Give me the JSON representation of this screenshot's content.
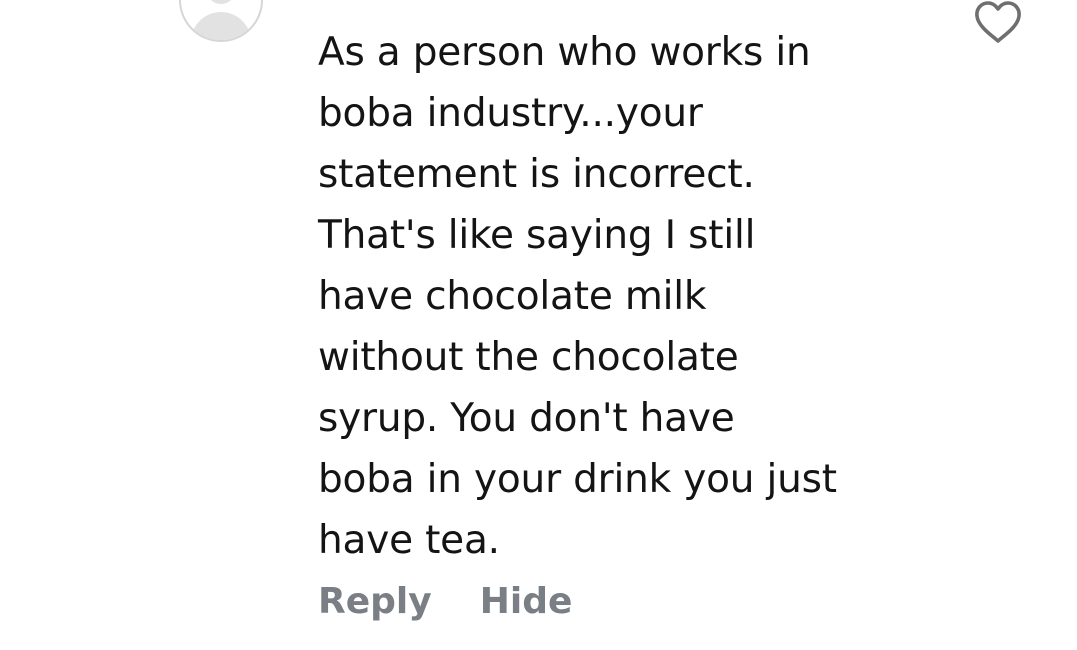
{
  "comment": {
    "username": "",
    "text_lines": [
      "As a person who works in",
      "boba industry...your",
      "statement is incorrect.",
      "That's like saying I still",
      "have chocolate milk",
      "without the chocolate",
      "syrup. You don't have",
      "boba in your drink you just",
      "have tea."
    ],
    "actions": {
      "reply_label": "Reply",
      "hide_label": "Hide"
    },
    "like_icon": "heart-outline-icon",
    "avatar_icon": "default-avatar-icon"
  },
  "colors": {
    "text": "#141414",
    "action_text": "#7a7f85",
    "icon_stroke": "#6f6f6f",
    "avatar_border": "#d6d6d6"
  }
}
